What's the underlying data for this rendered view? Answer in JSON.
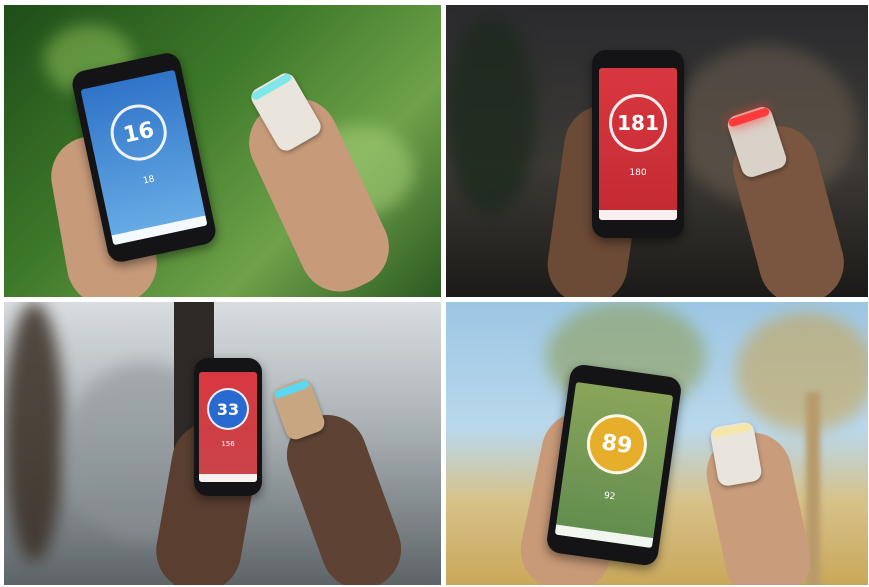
{
  "photos": [
    {
      "reading": "16",
      "secondary": "18",
      "theme_color": "#2f74c8",
      "device_light": "#7fe6ea"
    },
    {
      "reading": "181",
      "secondary": "180",
      "theme_color": "#d9373f",
      "device_light": "#ff3a3a"
    },
    {
      "reading": "33",
      "secondary": "156",
      "theme_color": "#2a6ad0",
      "device_light": "#5ad8f0"
    },
    {
      "reading": "89",
      "secondary": "92",
      "theme_color": "#e7ae2c",
      "device_light": "#f6e7a8"
    }
  ]
}
